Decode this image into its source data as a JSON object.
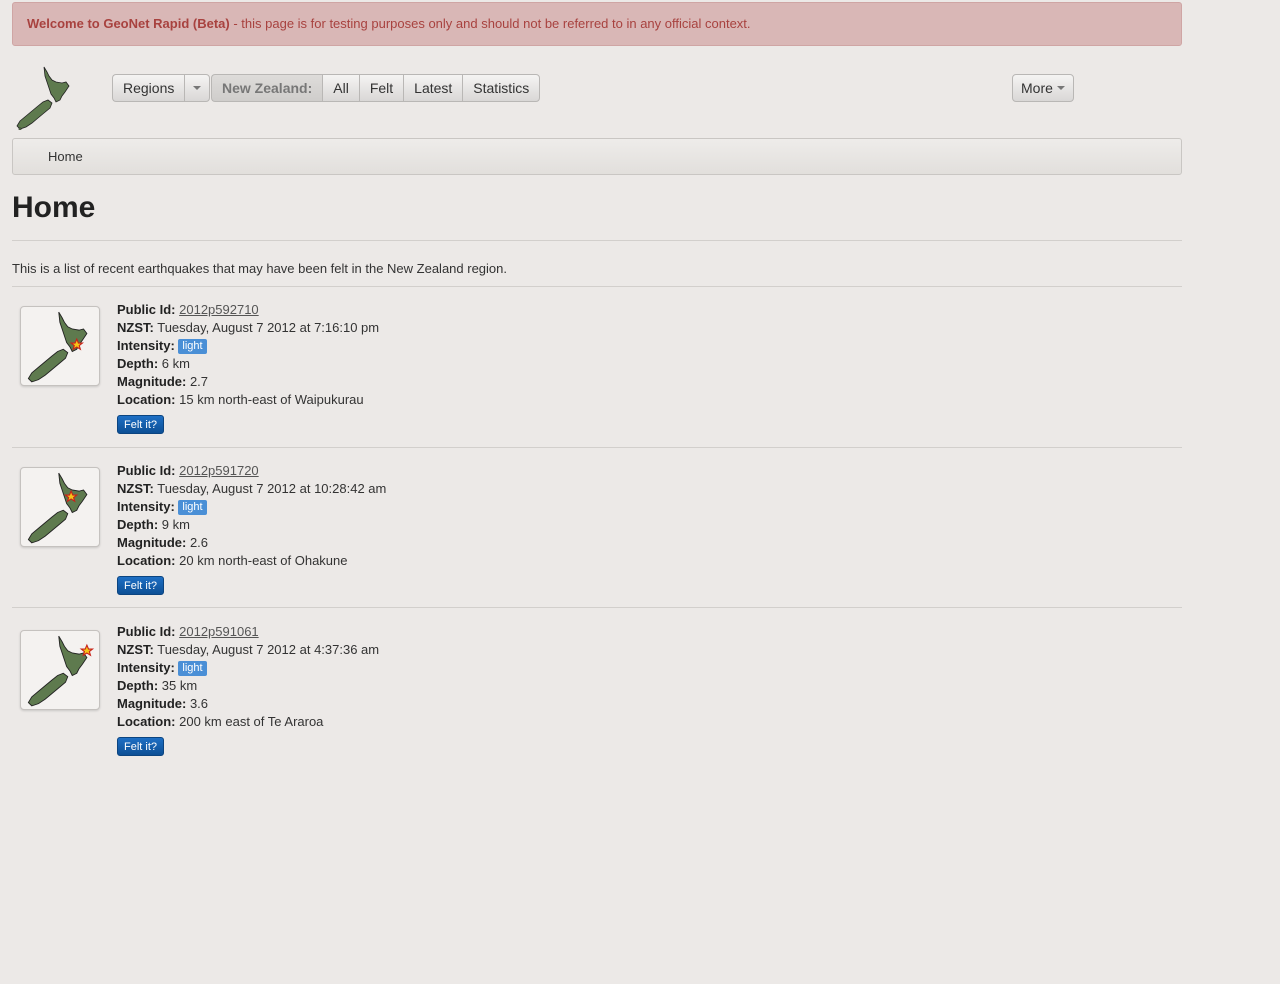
{
  "alert": {
    "strong": "Welcome to GeoNet Rapid (Beta)",
    "text": " - this page is for testing purposes only and should not be referred to in any official context."
  },
  "nav": {
    "regions_label": "Regions",
    "region_name": "New Zealand:",
    "all_label": "All",
    "felt_label": "Felt",
    "latest_label": "Latest",
    "statistics_label": "Statistics",
    "more_label": "More"
  },
  "breadcrumb": {
    "home": "Home"
  },
  "page": {
    "title": "Home",
    "intro": "This is a list of recent earthquakes that may have been felt in the New Zealand region."
  },
  "labels": {
    "public_id": "Public Id:",
    "nzst": "NZST:",
    "intensity": "Intensity:",
    "depth": "Depth:",
    "magnitude": "Magnitude:",
    "location": "Location:",
    "felt_button": "Felt it?"
  },
  "quakes": [
    {
      "public_id": "2012p592710",
      "time": "Tuesday, August 7 2012 at 7:16:10 pm",
      "intensity": "light",
      "depth": "6 km",
      "magnitude": "2.7",
      "location": "15 km north-east of Waipukurau"
    },
    {
      "public_id": "2012p591720",
      "time": "Tuesday, August 7 2012 at 10:28:42 am",
      "intensity": "light",
      "depth": "9 km",
      "magnitude": "2.6",
      "location": "20 km north-east of Ohakune"
    },
    {
      "public_id": "2012p591061",
      "time": "Tuesday, August 7 2012 at 4:37:36 am",
      "intensity": "light",
      "depth": "35 km",
      "magnitude": "3.6",
      "location": "200 km east of Te Araroa"
    }
  ],
  "colors": {
    "alert_bg": "#d9b7b6",
    "alert_text": "#a8423f",
    "badge": "#4a8fd6",
    "button_primary": "#0d4f95",
    "map_land": "#5e7a4e",
    "marker": "#c8231a"
  }
}
